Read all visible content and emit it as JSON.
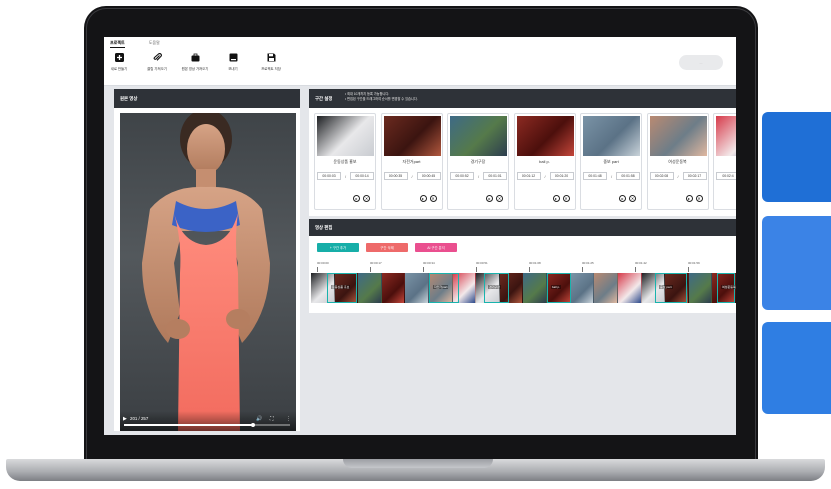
{
  "tabs": [
    {
      "label": "프로젝트",
      "active": true
    },
    {
      "label": "도움말",
      "active": false
    }
  ],
  "toolbar": [
    {
      "icon": "plus-square-icon",
      "label": "새로 만들기"
    },
    {
      "icon": "paperclip-icon",
      "label": "클립 가져오기"
    },
    {
      "icon": "briefcase-icon",
      "label": "원본 영상 가져오기"
    },
    {
      "icon": "download-icon",
      "label": "보내기"
    },
    {
      "icon": "save-icon",
      "label": "프로젝트 저장"
    }
  ],
  "source_panel": {
    "title": "원본 영상",
    "player": {
      "time": "201 / 257",
      "progress": 0.78
    }
  },
  "segment_panel": {
    "title": "구간 설정",
    "notes": [
      "최대 10개까지 등록 가능합니다.",
      "편집된 구간을 드래그하여 순서를 변경할 수 있습니다."
    ],
    "cards": [
      {
        "name": "운동상품 홍보",
        "start": "00:00:03",
        "end": "00:00:14"
      },
      {
        "name": "자전거part",
        "start": "00:00:35",
        "end": "00:00:45"
      },
      {
        "name": "경기구장",
        "start": "00:00:52",
        "end": "00:01:01"
      },
      {
        "name": "ball p.",
        "start": "00:01:12",
        "end": "00:01:20"
      },
      {
        "name": "중보 part",
        "start": "00:01:48",
        "end": "00:01:58"
      },
      {
        "name": "여성운동복",
        "start": "00:02:08",
        "end": "00:02:17"
      },
      {
        "name": "",
        "start": "00:02:4",
        "end": ""
      }
    ]
  },
  "edit_panel": {
    "title": "영상 편집",
    "buttons": [
      {
        "label": "+ 구간 추가",
        "color": "#17aea8"
      },
      {
        "label": "구간 삭제",
        "color": "#ee6a6a"
      },
      {
        "label": "AI 구간 분석",
        "color": "#ea4f8f"
      }
    ],
    "ruler": [
      "00:00:00",
      "00:00:17",
      "00:00:34",
      "00:00:51",
      "00:01:08",
      "00:01:25",
      "00:01:42",
      "00:01:59"
    ],
    "segments": [
      "운동상품 홍보",
      "자전거part",
      "경기구장",
      "ball p.",
      "중보 part",
      "여성운동복"
    ]
  },
  "colors": {
    "accent_teal": "#17aea8",
    "accent_red": "#ee6a6a",
    "accent_pink": "#ea4f8f",
    "panel_header": "#2e3238",
    "side_blue_1": "#1f6fd6",
    "side_blue_2": "#3b83e6",
    "side_blue_3": "#2f7ee3"
  }
}
